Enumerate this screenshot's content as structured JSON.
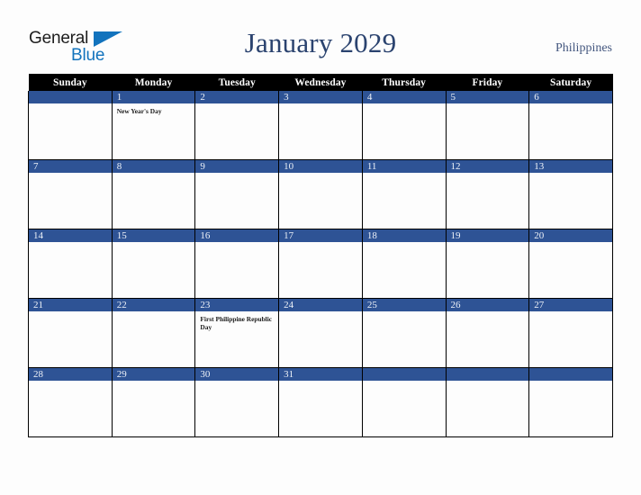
{
  "brand": {
    "name_part1": "General",
    "name_part2": "Blue",
    "triangle_color": "#1273bd"
  },
  "header": {
    "title": "January 2029",
    "country": "Philippines",
    "title_color": "#2b436f"
  },
  "calendar": {
    "weekday_headers": [
      "Sunday",
      "Monday",
      "Tuesday",
      "Wednesday",
      "Thursday",
      "Friday",
      "Saturday"
    ],
    "header_bg": "#000000",
    "daynum_bg": "#2e5395",
    "weeks": [
      [
        {
          "day": "",
          "holiday": ""
        },
        {
          "day": "1",
          "holiday": "New Year's Day"
        },
        {
          "day": "2",
          "holiday": ""
        },
        {
          "day": "3",
          "holiday": ""
        },
        {
          "day": "4",
          "holiday": ""
        },
        {
          "day": "5",
          "holiday": ""
        },
        {
          "day": "6",
          "holiday": ""
        }
      ],
      [
        {
          "day": "7",
          "holiday": ""
        },
        {
          "day": "8",
          "holiday": ""
        },
        {
          "day": "9",
          "holiday": ""
        },
        {
          "day": "10",
          "holiday": ""
        },
        {
          "day": "11",
          "holiday": ""
        },
        {
          "day": "12",
          "holiday": ""
        },
        {
          "day": "13",
          "holiday": ""
        }
      ],
      [
        {
          "day": "14",
          "holiday": ""
        },
        {
          "day": "15",
          "holiday": ""
        },
        {
          "day": "16",
          "holiday": ""
        },
        {
          "day": "17",
          "holiday": ""
        },
        {
          "day": "18",
          "holiday": ""
        },
        {
          "day": "19",
          "holiday": ""
        },
        {
          "day": "20",
          "holiday": ""
        }
      ],
      [
        {
          "day": "21",
          "holiday": ""
        },
        {
          "day": "22",
          "holiday": ""
        },
        {
          "day": "23",
          "holiday": "First Philippine Republic Day"
        },
        {
          "day": "24",
          "holiday": ""
        },
        {
          "day": "25",
          "holiday": ""
        },
        {
          "day": "26",
          "holiday": ""
        },
        {
          "day": "27",
          "holiday": ""
        }
      ],
      [
        {
          "day": "28",
          "holiday": ""
        },
        {
          "day": "29",
          "holiday": ""
        },
        {
          "day": "30",
          "holiday": ""
        },
        {
          "day": "31",
          "holiday": ""
        },
        {
          "day": "",
          "holiday": ""
        },
        {
          "day": "",
          "holiday": ""
        },
        {
          "day": "",
          "holiday": ""
        }
      ]
    ]
  }
}
